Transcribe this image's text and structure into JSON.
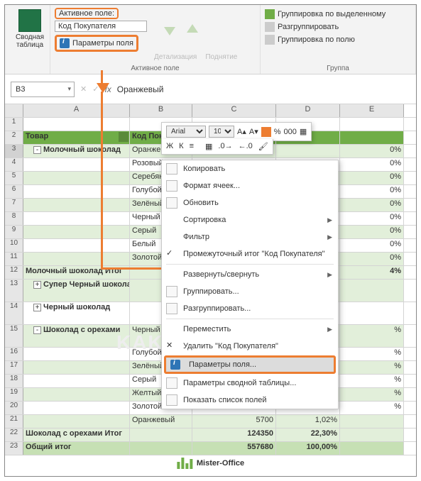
{
  "ribbon": {
    "pivot_btn": "Сводная\nтаблица",
    "active_field_label": "Активное поле:",
    "active_field_value": "Код Покупателя",
    "field_params": "Параметры поля",
    "drill_down": "Детализация",
    "drill_up": "Поднятие",
    "group_active": "Активное поле",
    "group_sel": "Группировка по выделенному",
    "ungroup": "Разгруппировать",
    "group_field": "Группировка по полю",
    "group_group": "Группа"
  },
  "formula": {
    "cell": "B3",
    "value": "Оранжевый"
  },
  "cols": [
    "A",
    "B",
    "C",
    "D",
    "E"
  ],
  "headers": {
    "product": "Товар",
    "buyer": "Код Покупателя"
  },
  "rows": [
    {
      "n": 3,
      "a": "Молочный шоколад",
      "b": "Оранжевы",
      "exp": "-",
      "band": true,
      "sel": true,
      "pct": "0%"
    },
    {
      "n": 4,
      "b": "Розовый",
      "pct": "0%"
    },
    {
      "n": 5,
      "b": "Серебяны",
      "pct": "0%",
      "band": true
    },
    {
      "n": 6,
      "b": "Голубой",
      "pct": "0%"
    },
    {
      "n": 7,
      "b": "Зелёный",
      "pct": "0%",
      "band": true
    },
    {
      "n": 8,
      "b": "Черный",
      "pct": "0%"
    },
    {
      "n": 9,
      "b": "Серый",
      "pct": "0%",
      "band": true
    },
    {
      "n": 10,
      "b": "Белый",
      "pct": "0%"
    },
    {
      "n": 11,
      "b": "Золотой",
      "pct": "0%",
      "band": true
    },
    {
      "n": 12,
      "a": "Молочный шоколад Итог",
      "sub": true,
      "pct": "4%"
    },
    {
      "n": 13,
      "a": "Супер Черный шоколад",
      "exp": "+",
      "band": true,
      "tall": true
    },
    {
      "n": 14,
      "a": "Черный шоколад",
      "exp": "+",
      "tall": true
    },
    {
      "n": 15,
      "a": "Шоколад с орехами",
      "b": "Черный",
      "exp": "-",
      "band": true,
      "tall": true,
      "pct": "%"
    },
    {
      "n": 16,
      "b": "Голубой",
      "pct": "%"
    },
    {
      "n": 17,
      "b": "Зелёный",
      "pct": "%",
      "band": true
    },
    {
      "n": 18,
      "b": "Серый",
      "pct": "%"
    },
    {
      "n": 19,
      "b": "Желтый",
      "pct": "%",
      "band": true
    },
    {
      "n": 20,
      "b": "Золотой",
      "pct": "%"
    },
    {
      "n": 21,
      "b": "Оранжевый",
      "c": "5700",
      "d": "1,02%",
      "band": true
    },
    {
      "n": 22,
      "a": "Шоколад с орехами Итог",
      "c": "124350",
      "d": "22,30%",
      "sub": true
    },
    {
      "n": 23,
      "a": "Общий итог",
      "c": "557680",
      "d": "100,00%",
      "grand": true
    }
  ],
  "mini": {
    "font": "Arial",
    "size": "10",
    "btns": [
      "Ж",
      "К"
    ]
  },
  "ctx": [
    {
      "ico": "copy",
      "label": "Копировать"
    },
    {
      "ico": "format",
      "label": "Формат ячеек..."
    },
    {
      "ico": "refresh",
      "label": "Обновить"
    },
    {
      "ico": "none",
      "label": "Сортировка",
      "arrow": true
    },
    {
      "ico": "none",
      "label": "Фильтр",
      "arrow": true
    },
    {
      "ico": "check",
      "label": "Промежуточный итог \"Код Покупателя\""
    },
    {
      "ico": "none",
      "label": "Развернуть/свернуть",
      "arrow": true,
      "sep": true
    },
    {
      "ico": "group",
      "label": "Группировать..."
    },
    {
      "ico": "ungroup",
      "label": "Разгруппировать..."
    },
    {
      "ico": "none",
      "label": "Переместить",
      "arrow": true,
      "sep": true
    },
    {
      "ico": "delete",
      "label": "Удалить \"Код Покупателя\""
    },
    {
      "ico": "info",
      "label": "Параметры поля...",
      "hl": true
    },
    {
      "ico": "pivot",
      "label": "Параметры сводной таблицы..."
    },
    {
      "ico": "list",
      "label": "Показать список полей"
    }
  ],
  "watermark": "KAKSDELAT.ORG",
  "footer": "Mister-Office"
}
